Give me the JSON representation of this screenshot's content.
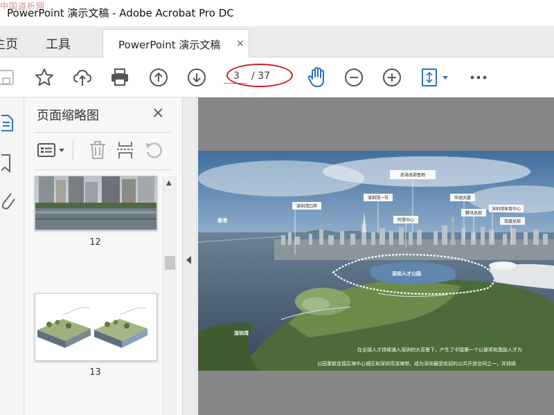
{
  "window": {
    "title": "PowerPoint 演示文稿 - Adobe Acrobat Pro DC",
    "watermark": "中国道析网"
  },
  "tabs": {
    "home": "主页",
    "tools": "工具",
    "document": "PowerPoint 演示文稿",
    "close_symbol": "×"
  },
  "toolbar": {
    "buttons": [
      "save-icon",
      "star-icon",
      "upload-cloud-icon",
      "print-icon",
      "page-up-icon",
      "page-down-icon",
      "hand-tool-icon",
      "zoom-out-icon",
      "zoom-in-icon",
      "fit-page-icon",
      "more-icon"
    ],
    "page_current": "3",
    "page_total": "/ 37"
  },
  "thumbnails_panel": {
    "title": "页面缩略图",
    "close_symbol": "×",
    "pages": [
      {
        "number": "12"
      },
      {
        "number": "13"
      }
    ]
  },
  "document_page": {
    "labels": {
      "houhai_hq": "后海总部基地",
      "shenzhen_bay_port": "深圳湾口岸",
      "shenzhen_bay_one": "深圳湾一号",
      "china_resources": "华润大厦",
      "alibaba": "阿里中心",
      "tencent": "腾讯总部",
      "sports_center": "深圳湾体育中心",
      "baidu": "百度总部",
      "hong_kong": "香港",
      "talent_park": "深圳人才公园",
      "shenzhen_bay": "深圳湾"
    },
    "caption_line1": "在全球人才持续涌入深圳的大背景下，产生了中国第一个以褒奖和激励人才为",
    "caption_line2": "公园重新连接后海中心城区和深圳湾滨海带，成为深圳最受欢迎的公共开放空间之一，并持续"
  },
  "colors": {
    "accent_blue": "#2a6fc9",
    "highlight_red": "#d3191b",
    "viewer_bg": "#878787"
  }
}
